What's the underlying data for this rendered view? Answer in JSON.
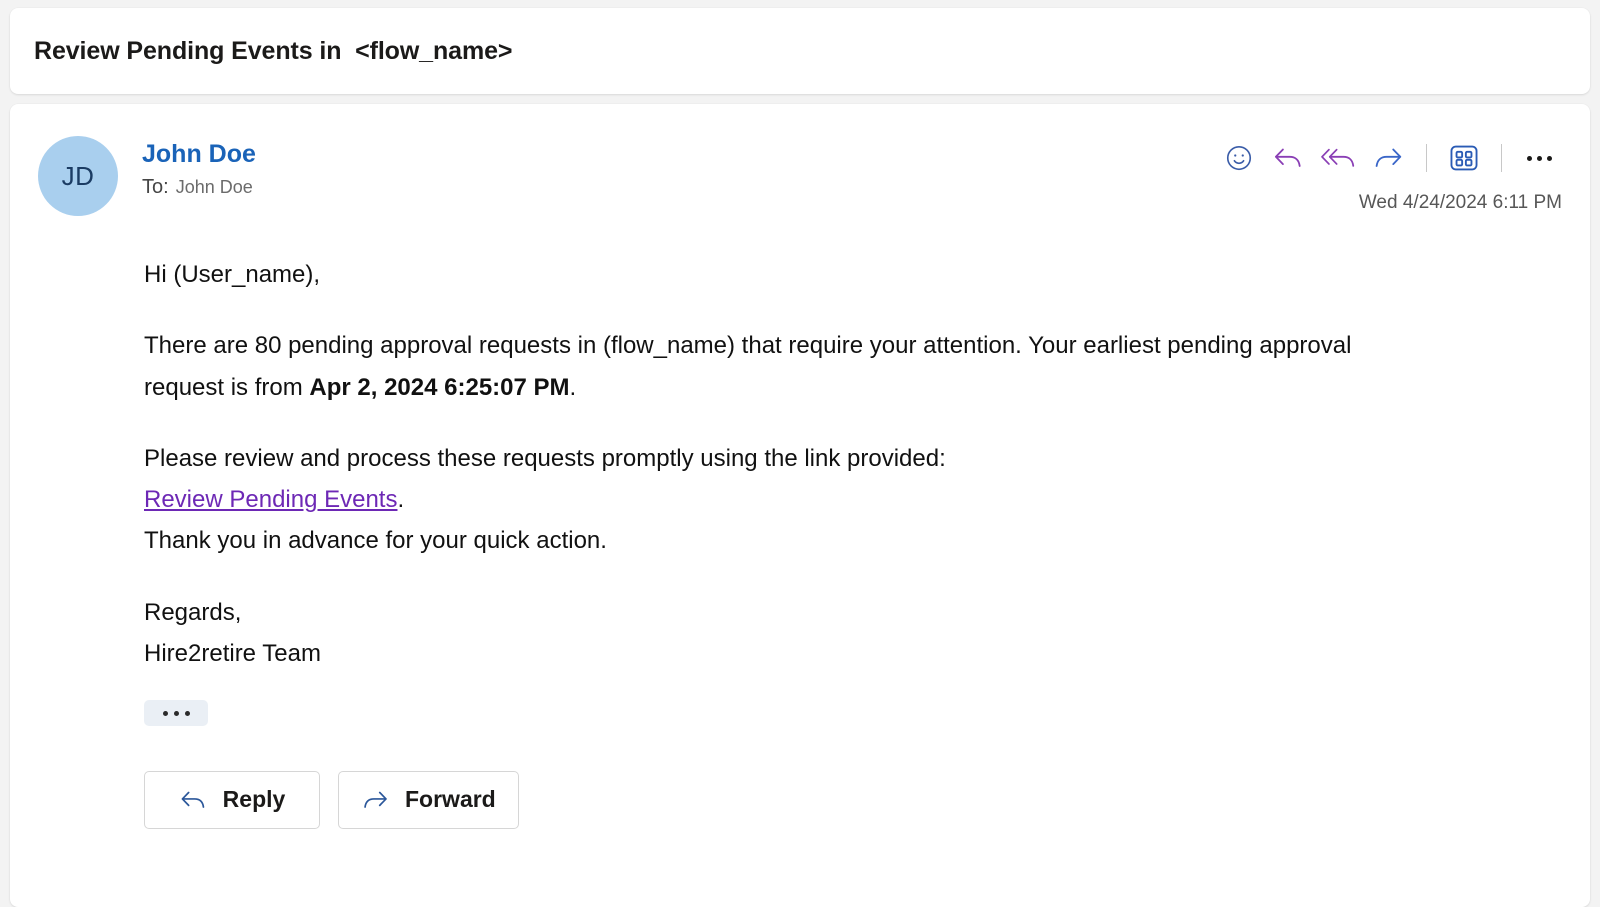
{
  "subject": {
    "text": "Review Pending Events in  <flow_name>"
  },
  "message": {
    "avatar_initials": "JD",
    "sender_name": "John Doe",
    "to_label": "To:",
    "to_value": "John Doe",
    "timestamp": "Wed 4/24/2024 6:11 PM",
    "header_actions": [
      {
        "name": "react-icon",
        "tooltip": "React"
      },
      {
        "name": "reply-icon",
        "tooltip": "Reply"
      },
      {
        "name": "reply-all-icon",
        "tooltip": "Reply all"
      },
      {
        "name": "forward-icon",
        "tooltip": "Forward"
      },
      {
        "name": "apps-icon",
        "tooltip": "Apps"
      },
      {
        "name": "more-options-icon",
        "tooltip": "More options"
      }
    ],
    "body": {
      "greeting": "Hi (User_name),",
      "paragraph_1_part_1": "There are 80 pending approval requests in (flow_name) that require your attention. Your earliest pending approval request is from ",
      "paragraph_1_bold": "Apr 2, 2024 6:25:07 PM",
      "paragraph_1_part_2": ".",
      "paragraph_2_line_1": "Please review and process these requests promptly using the link provided:",
      "link_text": "Review Pending Events",
      "link_trailing": ".",
      "paragraph_2_line_3": "Thank you in advance for your quick action.",
      "signature_line_1": "Regards,",
      "signature_line_2": "Hire2retire Team",
      "expand_label": "..."
    },
    "footer_buttons": [
      {
        "name": "reply-button",
        "label": "Reply"
      },
      {
        "name": "forward-button",
        "label": "Forward"
      }
    ]
  },
  "colors": {
    "page_background": "#f3f3f3",
    "card_background": "#ffffff",
    "sender_blue": "#1a63b8",
    "avatar_background": "#a9cfee",
    "avatar_text": "#1b3c63",
    "link_purple": "#6d28b5",
    "reply_icon_purple": "#8a3fb5",
    "forward_icon_blue": "#3a66c8",
    "chip_background": "#eaeff5"
  }
}
